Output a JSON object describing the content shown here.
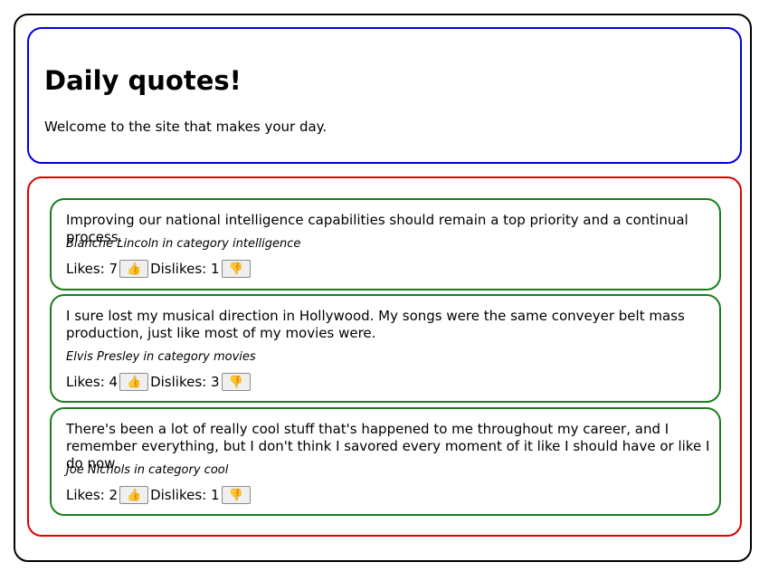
{
  "header": {
    "title": "Daily quotes!",
    "tagline": "Welcome to the site that makes your day."
  },
  "quotes": [
    {
      "text": "Improving our national intelligence capabilities should remain a top priority and a continual process.",
      "author_line": "Blanche Lincoln in category intelligence",
      "likes_label": "Likes: 7",
      "dislikes_label": "Dislikes: 1",
      "like_icon": "👍",
      "dislike_icon": "👎"
    },
    {
      "text": "I sure lost my musical direction in Hollywood. My songs were the same conveyer belt mass production, just like most of my movies were.",
      "author_line": "Elvis Presley in category movies",
      "likes_label": "Likes: 4",
      "dislikes_label": "Dislikes: 3",
      "like_icon": "👍",
      "dislike_icon": "👎"
    },
    {
      "text": "There's been a lot of really cool stuff that's happened to me throughout my career, and I remember everything, but I don't think I savored every moment of it like I should have or like I do now.",
      "author_line": "Joe Nichols in category cool",
      "likes_label": "Likes: 2",
      "dislikes_label": "Dislikes: 1",
      "like_icon": "👍",
      "dislike_icon": "👎"
    }
  ]
}
